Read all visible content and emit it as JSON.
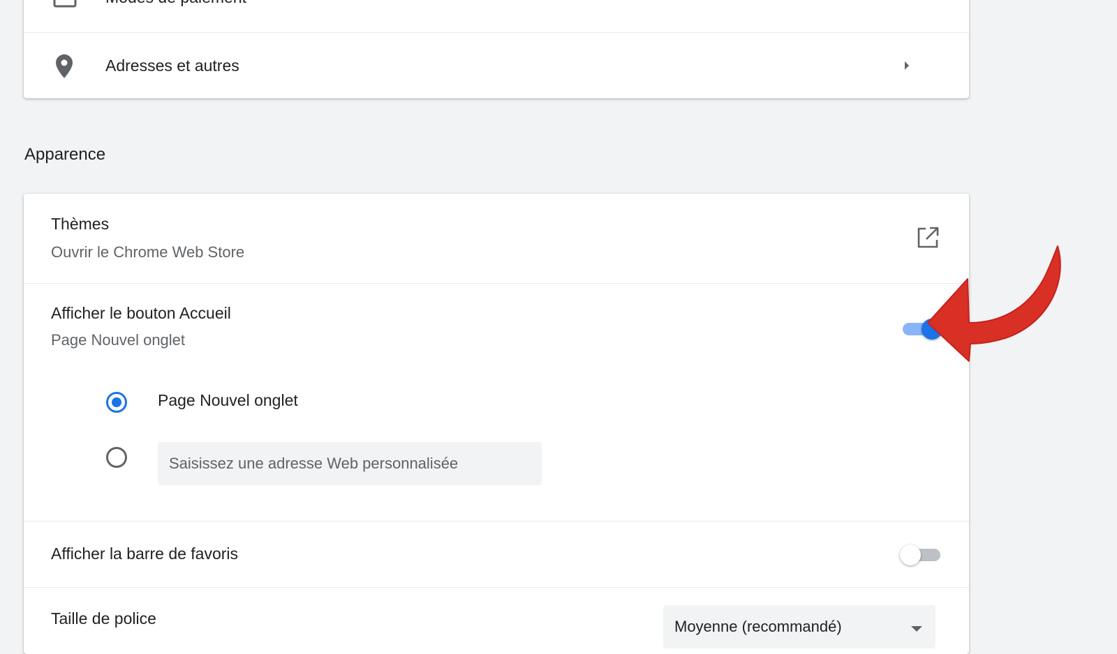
{
  "autofill": {
    "payment_label": "Modes de paiement",
    "addresses_label": "Adresses et autres"
  },
  "appearance": {
    "section_title": "Apparence",
    "themes": {
      "label": "Thèmes",
      "sublabel": "Ouvrir le Chrome Web Store",
      "icon": "open-in-new-icon"
    },
    "home_button": {
      "label": "Afficher le bouton Accueil",
      "sublabel": "Page Nouvel onglet",
      "enabled": true,
      "options": [
        {
          "label": "Page Nouvel onglet",
          "checked": true
        },
        {
          "placeholder": "Saisissez une adresse Web personnalisée",
          "value": "",
          "checked": false
        }
      ]
    },
    "bookmarks_bar": {
      "label": "Afficher la barre de favoris",
      "enabled": false
    },
    "font_size": {
      "label": "Taille de police",
      "selected": "Moyenne (recommandé)"
    }
  },
  "colors": {
    "accent": "#1a73e8",
    "accent_light": "#8ab4f8",
    "annotation_arrow": "#d93025",
    "background": "#f1f3f4"
  }
}
